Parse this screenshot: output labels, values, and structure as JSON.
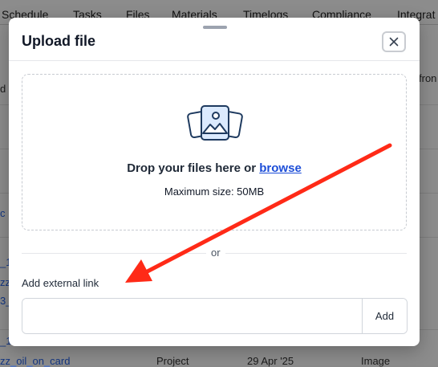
{
  "background": {
    "tabs": [
      "Schedule",
      "Tasks",
      "Files",
      "Materials",
      "Timelogs",
      "Compliance",
      "Integrat"
    ],
    "side_texts": [
      "d",
      "fron"
    ],
    "left_links": [
      "c",
      "_1",
      "zz",
      "3_",
      "_1"
    ],
    "bottom_row": {
      "name": "zz_oil_on_card",
      "type": "Project",
      "date": "29 Apr '25",
      "kind": "Image"
    }
  },
  "modal": {
    "title": "Upload file",
    "close_icon": "close-icon",
    "dropzone": {
      "icon": "images-icon",
      "text_prefix": "Drop your files here or ",
      "browse_label": "browse",
      "subtext": "Maximum size: 50MB"
    },
    "or_label": "or",
    "external_link": {
      "label": "Add external link",
      "value": "",
      "placeholder": "",
      "add_label": "Add"
    }
  },
  "annotation": {
    "arrow_color": "#ff2a17"
  }
}
